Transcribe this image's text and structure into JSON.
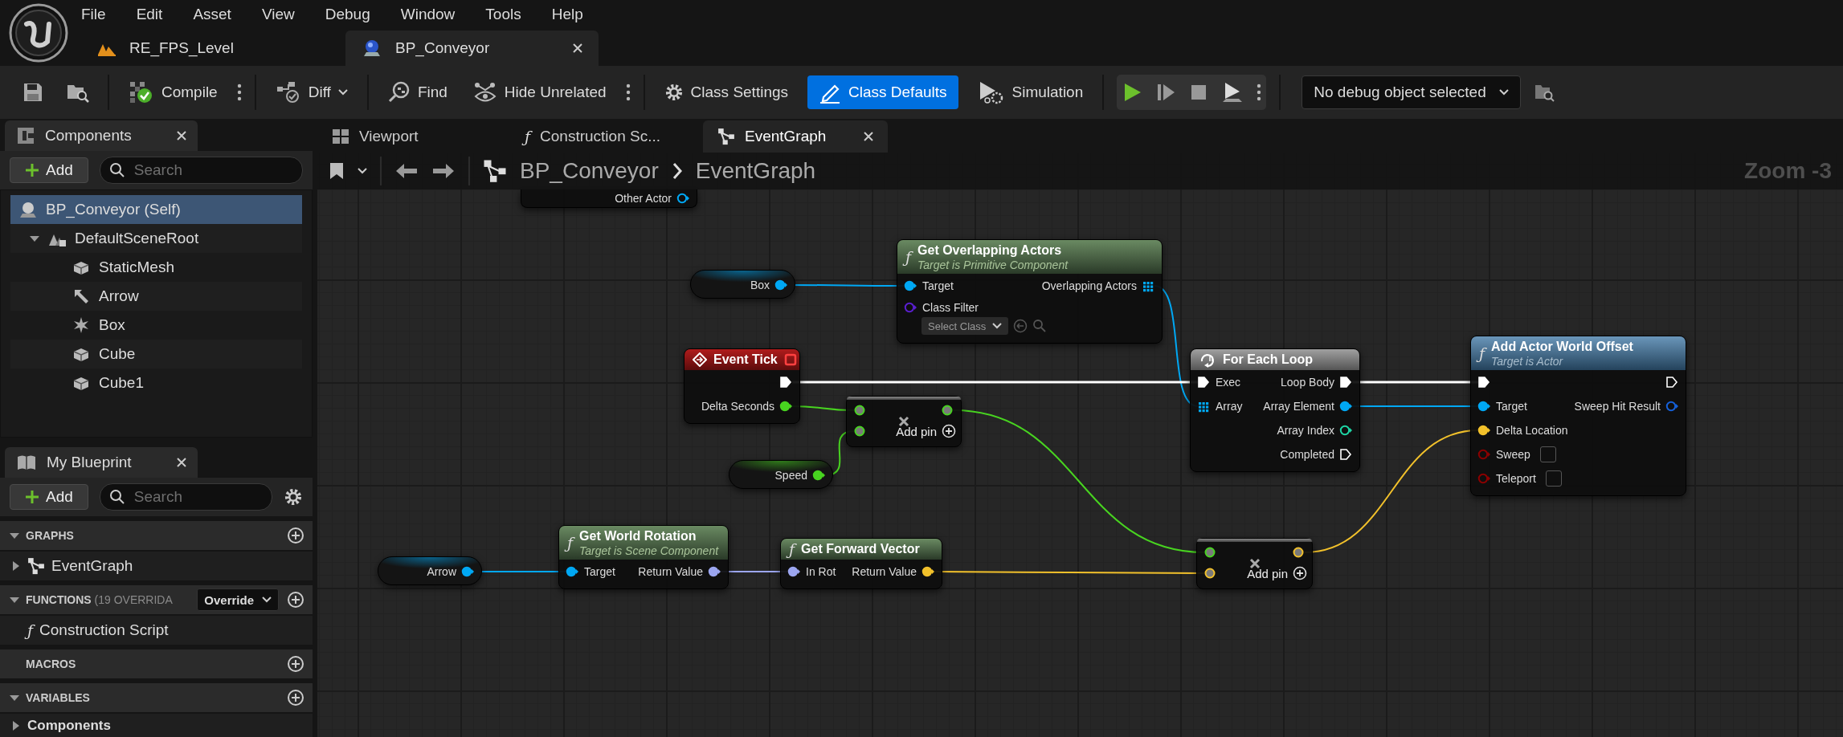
{
  "menu": [
    "File",
    "Edit",
    "Asset",
    "View",
    "Debug",
    "Window",
    "Tools",
    "Help"
  ],
  "document_tabs": [
    {
      "label": "RE_FPS_Level",
      "kind": "level",
      "selected": false
    },
    {
      "label": "BP_Conveyor",
      "kind": "blueprint",
      "selected": true
    }
  ],
  "toolbar": {
    "compile": "Compile",
    "diff": "Diff",
    "find": "Find",
    "hide_unrelated": "Hide Unrelated",
    "settings": [
      {
        "label": "Class Settings",
        "kind": "settings",
        "selected": false
      },
      {
        "label": "Class Defaults",
        "kind": "defaults",
        "selected": true
      }
    ],
    "simulation": "Simulation",
    "debug_object": "No debug object selected"
  },
  "components": {
    "title": "Components",
    "add": "Add",
    "search": {
      "placeholder": "Search"
    },
    "tree": [
      {
        "label": "BP_Conveyor (Self)",
        "kind": "actor",
        "selected": true
      },
      {
        "label": "DefaultSceneRoot",
        "kind": "scene",
        "selected": false,
        "expanded": true,
        "children": [
          {
            "label": "StaticMesh",
            "kind": "mesh",
            "selected": false
          },
          {
            "label": "Arrow",
            "kind": "arrow",
            "selected": false
          },
          {
            "label": "Box",
            "kind": "collision",
            "selected": false
          },
          {
            "label": "Cube",
            "kind": "mesh",
            "selected": false
          },
          {
            "label": "Cube1",
            "kind": "mesh",
            "selected": false
          }
        ]
      }
    ]
  },
  "my_blueprint": {
    "title": "My Blueprint",
    "add": "Add",
    "search": {
      "placeholder": "Search"
    },
    "sections": [
      {
        "label": "GRAPHS",
        "expanded": true,
        "items": [
          {
            "label": "EventGraph",
            "kind": "graph",
            "expanded": false
          }
        ]
      },
      {
        "label": "FUNCTIONS",
        "count": "(19 OVERRIDA",
        "dropdown": "Override",
        "expanded": true,
        "items": [
          {
            "label": "Construction Script",
            "kind": "function",
            "glyph": "ƒ"
          }
        ]
      },
      {
        "label": "MACROS"
      },
      {
        "label": "VARIABLES",
        "expanded": true,
        "items": [
          {
            "label": "Components",
            "kind": "category",
            "expanded": false
          }
        ]
      }
    ]
  },
  "editor_tabs": [
    {
      "label": "Viewport",
      "kind": "viewport",
      "selected": false
    },
    {
      "label": "Construction Sc...",
      "kind": "script",
      "glyph": "ƒ",
      "selected": false
    },
    {
      "label": "EventGraph",
      "kind": "graph",
      "selected": true
    }
  ],
  "graph": {
    "breadcrumb": [
      "BP_Conveyor",
      "EventGraph"
    ],
    "zoom": "Zoom -3",
    "nodes": [
      {
        "kind": "stub",
        "rows": [
          {
            "out": {
              "label": "Other Actor",
              "kind": "object",
              "connected": false
            }
          }
        ]
      },
      {
        "kind": "variable",
        "rows": [
          {
            "out": {
              "label": "Box",
              "kind": "object",
              "connected": true
            }
          }
        ]
      },
      {
        "kind": "pure_function",
        "glyph": "ƒ",
        "title": "Get Overlapping Actors",
        "subtitle": "Target is Primitive Component",
        "rows": [
          {
            "in": {
              "label": "Target",
              "kind": "object",
              "connected": true
            },
            "out": {
              "label": "Overlapping Actors",
              "kind": "array",
              "connected": true
            }
          },
          {
            "in": {
              "label": "Class Filter",
              "kind": "class",
              "connected": false,
              "select": "Select Class"
            }
          }
        ]
      },
      {
        "kind": "event",
        "title": "Event Tick",
        "rows": [
          {
            "out": {
              "kind": "exec",
              "connected": true
            }
          },
          {
            "out": {
              "label": "Delta Seconds",
              "kind": "float",
              "connected": true
            }
          }
        ]
      },
      {
        "kind": "operator",
        "add_pin": "Add pin",
        "rows": [
          {
            "in": {
              "kind": "float",
              "connected": true
            },
            "out": {
              "kind": "float",
              "connected": true
            }
          },
          {
            "in": {
              "kind": "float",
              "connected": true
            }
          }
        ]
      },
      {
        "kind": "variable",
        "rows": [
          {
            "out": {
              "label": "Speed",
              "kind": "float",
              "connected": true
            }
          }
        ]
      },
      {
        "kind": "macro",
        "title": "For Each Loop",
        "rows": [
          {
            "in": {
              "label": "Exec",
              "kind": "exec",
              "connected": true
            },
            "out": {
              "label": "Loop Body",
              "kind": "exec",
              "connected": true
            }
          },
          {
            "in": {
              "label": "Array",
              "kind": "array",
              "connected": true
            },
            "out": {
              "label": "Array Element",
              "kind": "object",
              "connected": true
            }
          },
          {
            "out": {
              "label": "Array Index",
              "kind": "int",
              "connected": false
            }
          },
          {
            "out": {
              "label": "Completed",
              "kind": "exec",
              "connected": false
            }
          }
        ]
      },
      {
        "kind": "function",
        "glyph": "ƒ",
        "title": "Add Actor World Offset",
        "subtitle": "Target is Actor",
        "rows": [
          {
            "in": {
              "kind": "exec",
              "connected": true
            },
            "out": {
              "kind": "exec",
              "connected": false
            }
          },
          {
            "in": {
              "label": "Target",
              "kind": "object",
              "connected": true
            },
            "out": {
              "label": "Sweep Hit Result",
              "kind": "struct",
              "connected": false
            }
          },
          {
            "in": {
              "label": "Delta Location",
              "kind": "vector",
              "connected": true
            }
          },
          {
            "in": {
              "label": "Sweep",
              "kind": "bool",
              "connected": false,
              "checked": false
            }
          },
          {
            "in": {
              "label": "Teleport",
              "kind": "bool",
              "connected": false,
              "checked": false
            }
          }
        ]
      },
      {
        "kind": "variable",
        "rows": [
          {
            "out": {
              "label": "Arrow",
              "kind": "object",
              "connected": true
            }
          }
        ]
      },
      {
        "kind": "pure_function",
        "glyph": "ƒ",
        "title": "Get World Rotation",
        "subtitle": "Target is Scene Component",
        "rows": [
          {
            "in": {
              "label": "Target",
              "kind": "object",
              "connected": true
            },
            "out": {
              "label": "Return Value",
              "kind": "rotator",
              "connected": true
            }
          }
        ]
      },
      {
        "kind": "pure_function",
        "glyph": "ƒ",
        "title": "Get Forward Vector",
        "rows": [
          {
            "in": {
              "label": "In Rot",
              "kind": "rotator",
              "connected": true
            },
            "out": {
              "label": "Return Value",
              "kind": "vector",
              "connected": true
            }
          }
        ]
      },
      {
        "kind": "operator",
        "add_pin": "Add pin",
        "rows": [
          {
            "in": {
              "kind": "float",
              "connected": true
            },
            "out": {
              "kind": "vector",
              "connected": true
            }
          },
          {
            "in": {
              "kind": "vector",
              "connected": true
            }
          }
        ]
      }
    ]
  }
}
